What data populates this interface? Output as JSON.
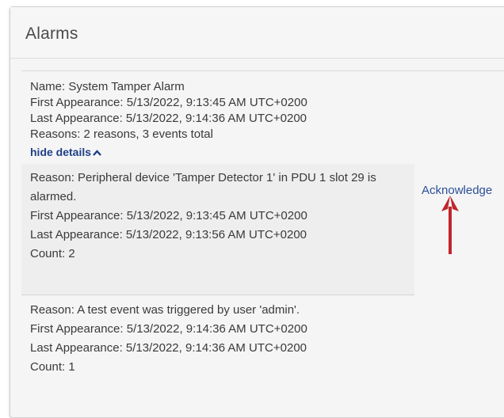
{
  "panel": {
    "title": "Alarms"
  },
  "alarm": {
    "name": "Name: System Tamper Alarm",
    "first_appearance": "First Appearance: 5/13/2022, 9:13:45 AM UTC+0200",
    "last_appearance": "Last Appearance: 5/13/2022, 9:14:36 AM UTC+0200",
    "reasons_summary": "Reasons: 2 reasons, 3 events total",
    "hide_details_label": "hide details",
    "acknowledge_label": "Acknowledge",
    "reasons": [
      {
        "reason": "Reason: Peripheral device 'Tamper Detector 1' in PDU 1 slot 29 is alarmed.",
        "first_appearance": "First Appearance: 5/13/2022, 9:13:45 AM UTC+0200",
        "last_appearance": "Last Appearance: 5/13/2022, 9:13:56 AM UTC+0200",
        "count": "Count: 2"
      },
      {
        "reason": "Reason: A test event was triggered by user 'admin'.",
        "first_appearance": "First Appearance: 5/13/2022, 9:14:36 AM UTC+0200",
        "last_appearance": "Last Appearance: 5/13/2022, 9:14:36 AM UTC+0200",
        "count": "Count: 1"
      }
    ]
  },
  "colors": {
    "link": "#1f3f86",
    "annotation_arrow": "#c0252b"
  },
  "icons": {
    "hide_details": "chevron-up-icon",
    "annotation": "arrow-up-icon"
  }
}
